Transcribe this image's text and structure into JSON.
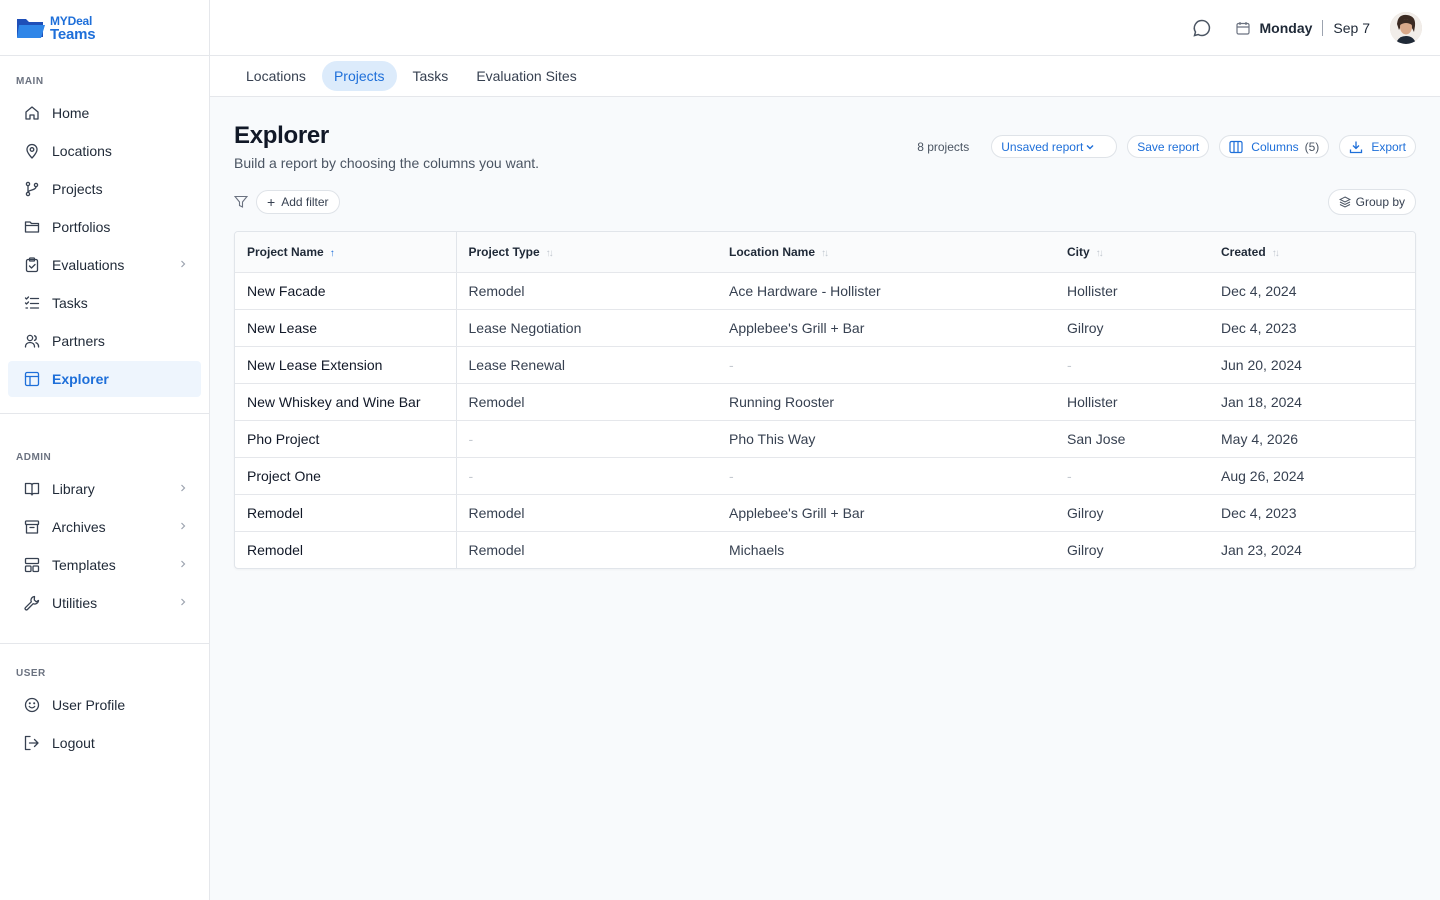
{
  "app": {
    "logo_top": "MYDeal",
    "logo_bottom": "Teams"
  },
  "header": {
    "day": "Monday",
    "date": "Sep 7"
  },
  "sidebar": {
    "sections": [
      {
        "label": "MAIN",
        "items": [
          {
            "label": "Home",
            "icon": "home-icon"
          },
          {
            "label": "Locations",
            "icon": "location-pin-icon"
          },
          {
            "label": "Projects",
            "icon": "branch-icon"
          },
          {
            "label": "Portfolios",
            "icon": "folder-icon"
          },
          {
            "label": "Evaluations",
            "icon": "clipboard-check-icon",
            "chevron": true
          },
          {
            "label": "Tasks",
            "icon": "task-list-icon"
          },
          {
            "label": "Partners",
            "icon": "users-icon"
          },
          {
            "label": "Explorer",
            "icon": "table-icon",
            "active": true
          }
        ]
      },
      {
        "label": "ADMIN",
        "items": [
          {
            "label": "Library",
            "icon": "book-icon",
            "chevron": true
          },
          {
            "label": "Archives",
            "icon": "archive-icon",
            "chevron": true
          },
          {
            "label": "Templates",
            "icon": "template-icon",
            "chevron": true
          },
          {
            "label": "Utilities",
            "icon": "wrench-icon",
            "chevron": true
          }
        ]
      },
      {
        "label": "USER",
        "items": [
          {
            "label": "User Profile",
            "icon": "smile-icon"
          },
          {
            "label": "Logout",
            "icon": "logout-icon"
          }
        ]
      }
    ]
  },
  "tabs": [
    {
      "label": "Locations"
    },
    {
      "label": "Projects",
      "active": true
    },
    {
      "label": "Tasks"
    },
    {
      "label": "Evaluation Sites"
    }
  ],
  "page": {
    "title": "Explorer",
    "subtitle": "Build a report by choosing the columns you want.",
    "count": "8 projects",
    "report_select": "Unsaved report",
    "save_label": "Save report",
    "columns_label": "Columns",
    "columns_count": "(5)",
    "export_label": "Export",
    "add_filter_label": "Add filter",
    "group_by_label": "Group by"
  },
  "table": {
    "columns": [
      "Project Name",
      "Project Type",
      "Location Name",
      "City",
      "Created"
    ],
    "sorted_column": "Project Name",
    "rows": [
      [
        "New Facade",
        "Remodel",
        "Ace Hardware - Hollister",
        "Hollister",
        "Dec 4, 2024"
      ],
      [
        "New Lease",
        "Lease Negotiation",
        "Applebee's Grill + Bar",
        "Gilroy",
        "Dec 4, 2023"
      ],
      [
        "New Lease Extension",
        "Lease Renewal",
        "-",
        "-",
        "Jun 20, 2024"
      ],
      [
        "New Whiskey and Wine Bar",
        "Remodel",
        "Running Rooster",
        "Hollister",
        "Jan 18, 2024"
      ],
      [
        "Pho Project",
        "-",
        "Pho This Way",
        "San Jose",
        "May 4, 2026"
      ],
      [
        "Project One",
        "-",
        "-",
        "-",
        "Aug 26, 2024"
      ],
      [
        "Remodel",
        "Remodel",
        "Applebee's Grill + Bar",
        "Gilroy",
        "Dec 4, 2023"
      ],
      [
        "Remodel",
        "Remodel",
        "Michaels",
        "Gilroy",
        "Jan 23, 2024"
      ]
    ]
  },
  "colors": {
    "accent": "#1e6fd9",
    "active_bg": "#eef5fd",
    "tab_active_bg": "#dcebfb"
  }
}
